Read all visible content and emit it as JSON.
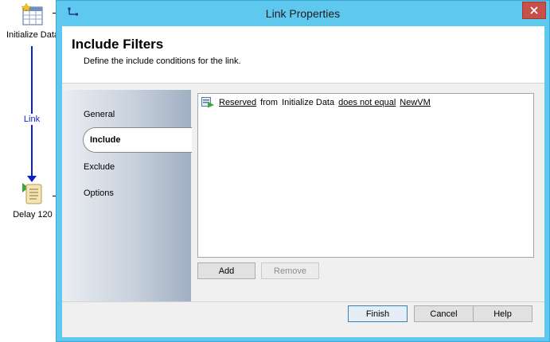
{
  "canvas": {
    "activities": [
      {
        "name": "initialize-data",
        "label": "Initialize Data"
      },
      {
        "name": "delay",
        "label": "Delay 120"
      }
    ],
    "link_label": "Link"
  },
  "dialog": {
    "title": "Link Properties",
    "header_title": "Include Filters",
    "header_subtitle": "Define the include conditions for the link.",
    "nav": {
      "items": [
        "General",
        "Include",
        "Exclude",
        "Options"
      ],
      "selected": "Include"
    },
    "filters": [
      {
        "property": "Reserved",
        "from_text": "from",
        "activity": "Initialize Data",
        "condition": "does not equal",
        "value": "NewVM"
      }
    ],
    "buttons": {
      "add": "Add",
      "remove": "Remove",
      "finish": "Finish",
      "cancel": "Cancel",
      "help": "Help"
    }
  },
  "colors": {
    "title_bar": "#5fc8ef",
    "close_button": "#c7504b",
    "link_line": "#0b1ec8"
  }
}
